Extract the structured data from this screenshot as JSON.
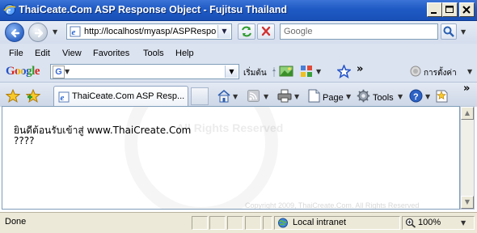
{
  "window": {
    "title": "ThaiCeate.Com ASP Response Object - Fujitsu Thailand"
  },
  "navbar": {
    "address": "http://localhost/myasp/ASPResponse.asp",
    "search_placeholder": "Google"
  },
  "menu": [
    "File",
    "Edit",
    "View",
    "Favorites",
    "Tools",
    "Help"
  ],
  "google_toolbar": {
    "logo": "Google",
    "start_label": "เริ่มต้น",
    "settings_label": "การตั้งค่า",
    "more": "»"
  },
  "tabs": [
    {
      "label": "ThaiCeate.Com ASP Resp..."
    }
  ],
  "command_bar": {
    "page_label": "Page",
    "tools_label": "Tools",
    "more": "»"
  },
  "content": {
    "line1": "ยินดีต้อนรับเข้าสู่ www.ThaiCreate.Com",
    "line2": "????",
    "watermark": "All Rights Reserved",
    "watermark_footer": "Copyright 2009, ThaiCreate.Com. All Rights Reserved"
  },
  "status": {
    "text": "Done",
    "zone": "Local intranet",
    "zoom": "100%"
  },
  "colors": {
    "titlebar": "#1f5ac4",
    "chrome": "#dbe3f0",
    "statusbar": "#ece9d8"
  }
}
